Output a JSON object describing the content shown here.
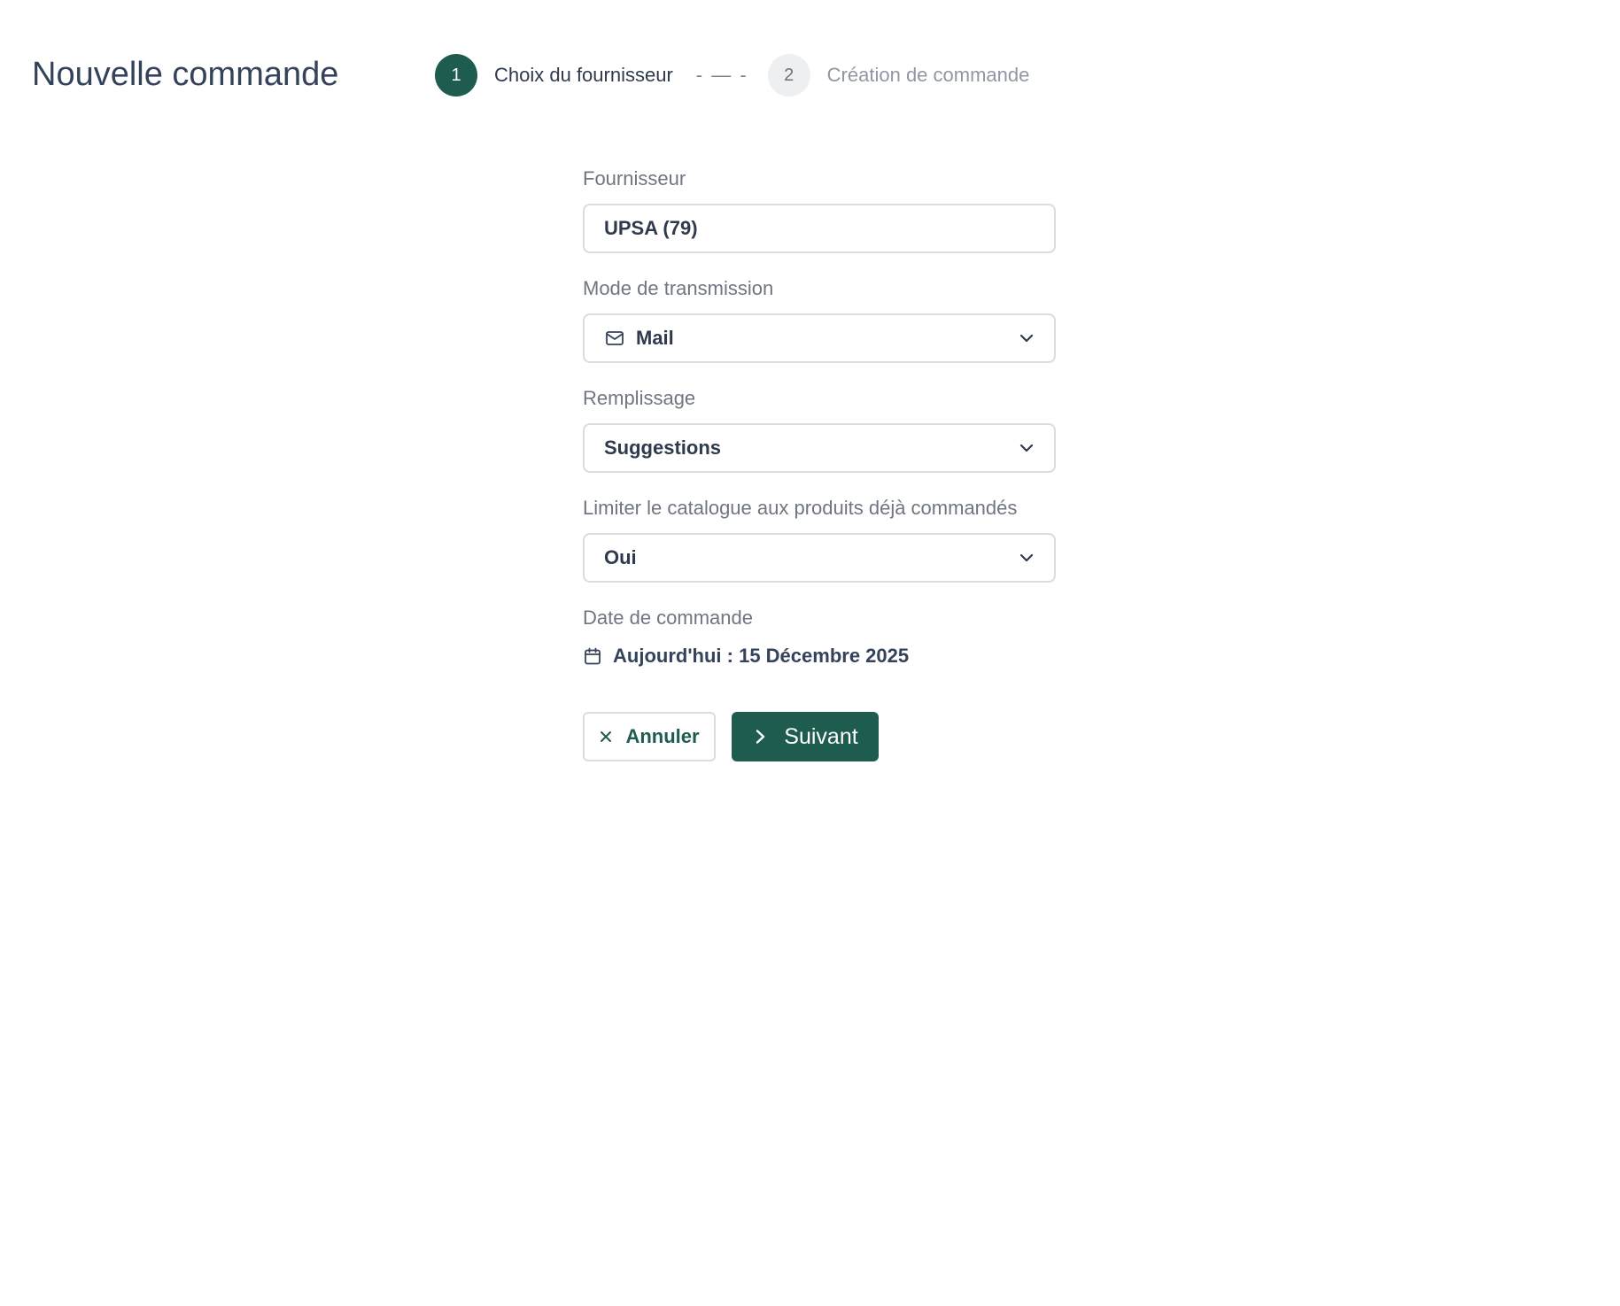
{
  "header": {
    "title": "Nouvelle commande"
  },
  "stepper": {
    "steps": [
      {
        "number": "1",
        "label": "Choix du fournisseur",
        "state": "active"
      },
      {
        "number": "2",
        "label": "Création de commande",
        "state": "inactive"
      }
    ],
    "separator": "- — -"
  },
  "form": {
    "supplier": {
      "label": "Fournisseur",
      "value": "UPSA (79)"
    },
    "transmission": {
      "label": "Mode de transmission",
      "value": "Mail",
      "icon": "mail-icon"
    },
    "filling": {
      "label": "Remplissage",
      "value": "Suggestions"
    },
    "limit_catalog": {
      "label": "Limiter le catalogue aux produits déjà commandés",
      "value": "Oui"
    },
    "order_date": {
      "label": "Date de commande",
      "value": "Aujourd'hui : 15 Décembre 2025",
      "icon": "calendar-icon"
    }
  },
  "actions": {
    "cancel_label": "Annuler",
    "next_label": "Suivant"
  },
  "colors": {
    "primary": "#1e5c4f",
    "text": "#2f3a4d",
    "muted": "#6f7682",
    "border": "#d9dce1"
  }
}
